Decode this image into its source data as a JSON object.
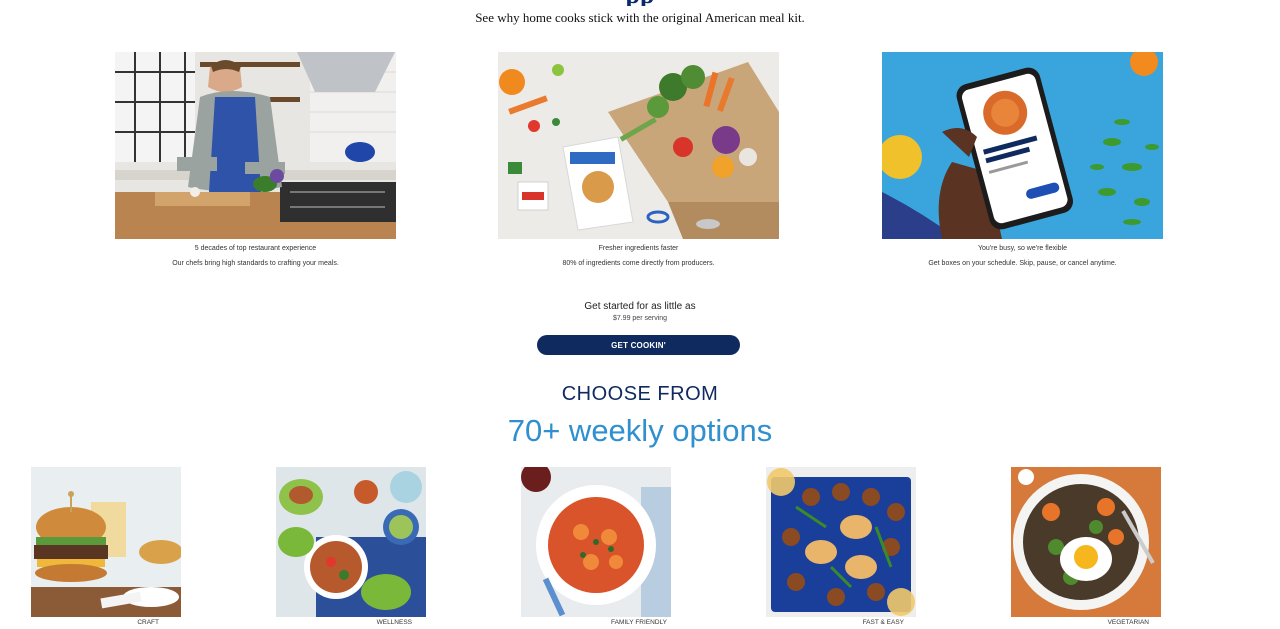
{
  "header": {
    "title_fragment": "pp",
    "subtitle": "See why home cooks stick with the original American meal kit."
  },
  "features": [
    {
      "title": "5 decades of top restaurant experience",
      "text": "Our chefs bring high standards to crafting your meals.",
      "image": "chef-cooking-photo"
    },
    {
      "title": "Fresher ingredients faster",
      "text": "80% of ingredients come directly from producers.",
      "image": "meal-kit-box-photo"
    },
    {
      "title": "You're busy, so we're flexible",
      "text": "Get boxes on your schedule. Skip, pause, or cancel anytime.",
      "image": "phone-app-photo"
    }
  ],
  "promo": {
    "line": "Get started for as little as",
    "price": "$7.99 per serving",
    "cta_label": "GET COOKIN'"
  },
  "menu_section": {
    "title": "CHOOSE FROM",
    "subtitle": "70+ weekly options"
  },
  "categories": [
    {
      "label": "CRAFT",
      "image": "burger-photo"
    },
    {
      "label": "WELLNESS",
      "image": "lettuce-wraps-photo"
    },
    {
      "label": "FAMILY FRIENDLY",
      "image": "pasta-bowl-photo"
    },
    {
      "label": "FAST & EASY",
      "image": "sheet-pan-photo"
    },
    {
      "label": "VEGETARIAN",
      "image": "egg-grain-bowl-photo"
    }
  ],
  "colors": {
    "brand_navy": "#0e2a5e",
    "accent_blue": "#2f8fcf"
  }
}
